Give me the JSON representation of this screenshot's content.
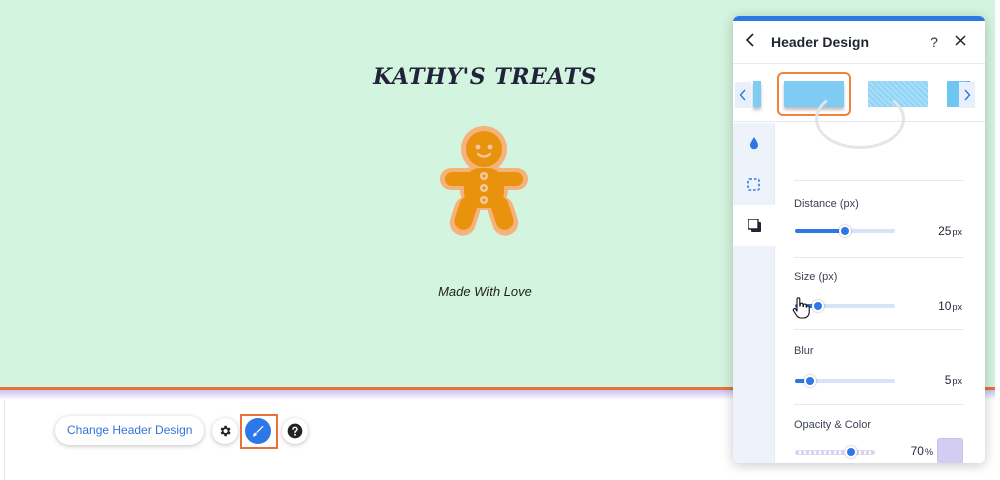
{
  "site": {
    "title": "KATHY'S TREATS",
    "tagline": "Made With Love"
  },
  "toolbar": {
    "change_header_label": "Change Header Design",
    "icons": [
      "gear-icon",
      "paintbrush-icon",
      "help-icon"
    ]
  },
  "panel": {
    "title": "Header Design",
    "help_glyph": "?",
    "close_glyph": "✕",
    "back_glyph": "‹",
    "side_tabs": [
      "fill-icon",
      "border-icon",
      "shadow-icon"
    ],
    "active_tab": "shadow-icon",
    "controls": {
      "distance": {
        "label": "Distance (px)",
        "value": "25",
        "unit": "px",
        "level": 0.5
      },
      "size": {
        "label": "Size (px)",
        "value": "10",
        "unit": "px",
        "level": 0.23
      },
      "blur": {
        "label": "Blur",
        "value": "5",
        "unit": "px",
        "level": 0.15
      },
      "opacity": {
        "label": "Opacity & Color",
        "value": "70",
        "unit": "%",
        "level": 0.7,
        "color": "#d3cdf2"
      }
    }
  },
  "colors": {
    "header_bg": "#d3f4de",
    "accent": "#2e77e6",
    "highlight": "#e8703a",
    "cookie": "#e8920e"
  }
}
